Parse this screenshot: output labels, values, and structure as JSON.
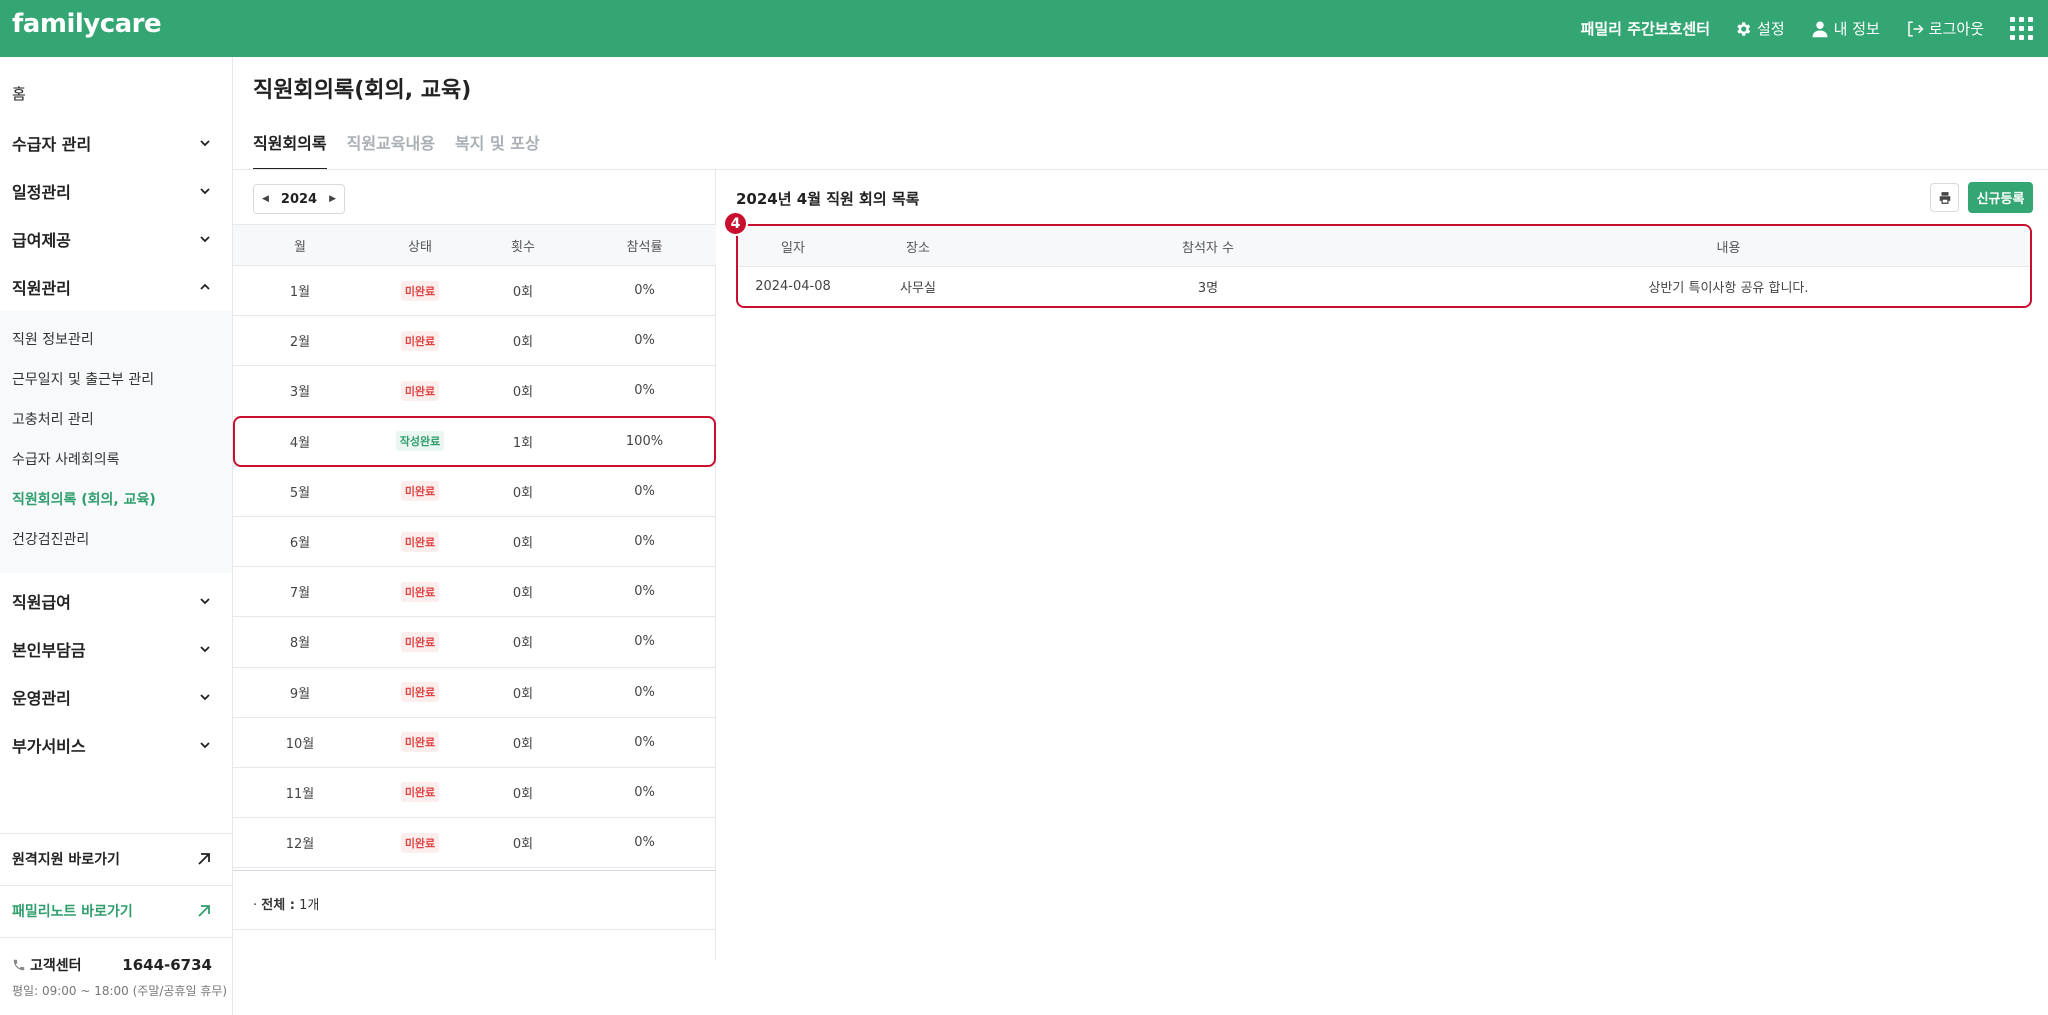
{
  "header": {
    "logo": "familycare",
    "center_name": "패밀리 주간보호센터",
    "settings_label": "설정",
    "profile_label": "내 정보",
    "logout_label": "로그아웃"
  },
  "sidebar": {
    "home": "홈",
    "items": [
      {
        "label": "수급자 관리"
      },
      {
        "label": "일정관리"
      },
      {
        "label": "급여제공"
      },
      {
        "label": "직원관리"
      },
      {
        "label": "직원급여"
      },
      {
        "label": "본인부담금"
      },
      {
        "label": "운영관리"
      },
      {
        "label": "부가서비스"
      }
    ],
    "submenu": [
      {
        "label": "직원 정보관리"
      },
      {
        "label": "근무일지 및 출근부 관리"
      },
      {
        "label": "고충처리 관리"
      },
      {
        "label": "수급자 사례회의록"
      },
      {
        "label": "직원회의록 (회의, 교육)"
      },
      {
        "label": "건강검진관리"
      }
    ],
    "remote_link": "원격지원 바로가기",
    "note_link": "패밀리노트 바로가기",
    "cs_label": "고객센터",
    "cs_phone": "1644-6734",
    "cs_hours": "평일: 09:00 ~ 18:00 (주말/공휴일 휴무)"
  },
  "page": {
    "title": "직원회의록(회의, 교육)",
    "tabs": [
      {
        "label": "직원회의록"
      },
      {
        "label": "직원교육내용"
      },
      {
        "label": "복지 및 포상"
      }
    ]
  },
  "months_panel": {
    "year": "2024",
    "headers": [
      "월",
      "상태",
      "횟수",
      "참석률"
    ],
    "rows": [
      {
        "month": "1월",
        "status": "미완료",
        "count": "0회",
        "rate": "0%"
      },
      {
        "month": "2월",
        "status": "미완료",
        "count": "0회",
        "rate": "0%"
      },
      {
        "month": "3월",
        "status": "미완료",
        "count": "0회",
        "rate": "0%"
      },
      {
        "month": "4월",
        "status": "작성완료",
        "count": "1회",
        "rate": "100%"
      },
      {
        "month": "5월",
        "status": "미완료",
        "count": "0회",
        "rate": "0%"
      },
      {
        "month": "6월",
        "status": "미완료",
        "count": "0회",
        "rate": "0%"
      },
      {
        "month": "7월",
        "status": "미완료",
        "count": "0회",
        "rate": "0%"
      },
      {
        "month": "8월",
        "status": "미완료",
        "count": "0회",
        "rate": "0%"
      },
      {
        "month": "9월",
        "status": "미완료",
        "count": "0회",
        "rate": "0%"
      },
      {
        "month": "10월",
        "status": "미완료",
        "count": "0회",
        "rate": "0%"
      },
      {
        "month": "11월",
        "status": "미완료",
        "count": "0회",
        "rate": "0%"
      },
      {
        "month": "12월",
        "status": "미완료",
        "count": "0회",
        "rate": "0%"
      }
    ],
    "total_label": "전체 :",
    "total_value": "1개"
  },
  "meeting_panel": {
    "title": "2024년 4월 직원 회의 목록",
    "new_button": "신규등록",
    "step_number": "4",
    "headers": [
      "일자",
      "장소",
      "참석자 수",
      "내용"
    ],
    "rows": [
      {
        "date": "2024-04-08",
        "place": "사무실",
        "attendees": "3명",
        "content": "상반기 특이사항 공유 합니다."
      }
    ]
  },
  "colors": {
    "brand": "#33a674",
    "highlight": "#c8102e",
    "pending": "#e04343",
    "done": "#2f9e6c"
  }
}
